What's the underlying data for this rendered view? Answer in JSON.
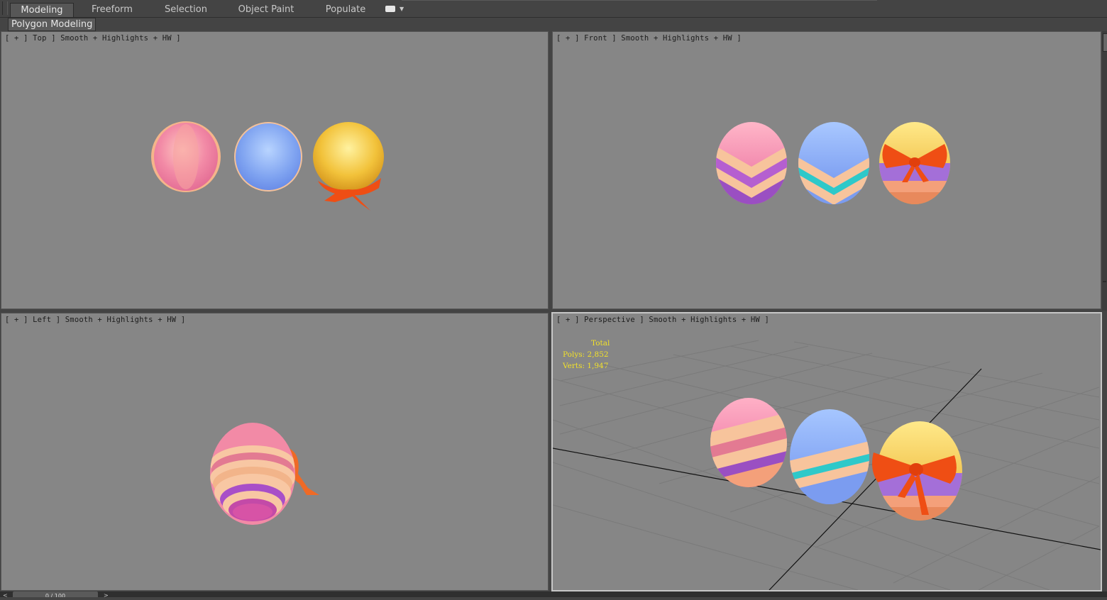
{
  "ribbon": {
    "tabs": [
      "Modeling",
      "Freeform",
      "Selection",
      "Object Paint",
      "Populate"
    ],
    "active_tab": "Modeling",
    "panel_label": "Polygon Modeling"
  },
  "viewports": {
    "top": {
      "label": "[ + ] Top ] Smooth + Highlights + HW ]"
    },
    "front": {
      "label": "[ + ] Front ] Smooth + Highlights + HW ]"
    },
    "left": {
      "label": "[ + ] Left ] Smooth + Highlights + HW ]"
    },
    "perspective": {
      "label": "[ + ] Perspective ] Smooth + Highlights + HW ]",
      "stats": {
        "total": "Total",
        "polys": "Polys:  2,852",
        "verts": "Verts:  1,947"
      }
    }
  },
  "timeline": {
    "frame": "0 / 100",
    "prev": "<",
    "next": ">"
  },
  "colors": {
    "viewport_bg": "#868686",
    "ui_bg": "#444444",
    "stats_text": "#f1e02a",
    "egg_pink": "#f07fa8",
    "egg_blue": "#7ea2f0",
    "egg_gold": "#f2c23a",
    "bow_orange": "#ef4e14"
  }
}
